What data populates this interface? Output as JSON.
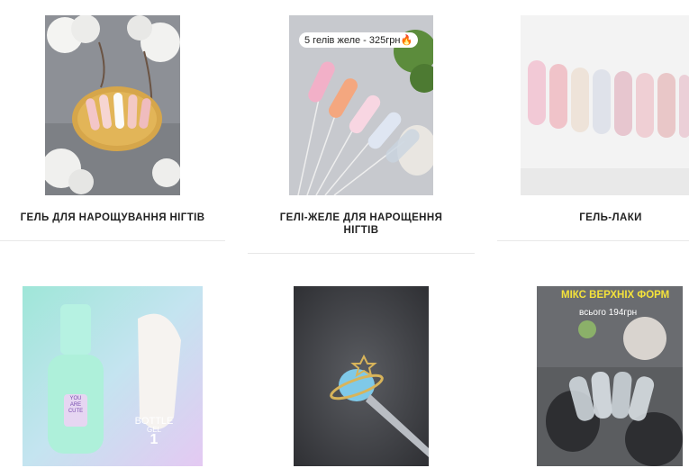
{
  "categories": [
    {
      "title": "ГЕЛЬ ДЛЯ НАРОЩУВАННЯ НІГТІВ",
      "image": "white-nail-gel-with-cotton-photo"
    },
    {
      "title": "ГЕЛІ-ЖЕЛЕ ДЛЯ НАРОЩЕННЯ НІГТІВ",
      "image": "jelly-gel-nail-tips-photo",
      "badge": "5 гелів желе - 325грн🔥"
    },
    {
      "title": "ГЕЛЬ-ЛАКИ",
      "image": "gel-polish-swatches-photo"
    },
    {
      "title": "",
      "image": "bottle-gel-photo",
      "brand_text": "YOU ARE CUTE",
      "bottle_label": "BOTTLE",
      "bottle_sub": "GEL",
      "bottle_num": "1"
    },
    {
      "title": "",
      "image": "planet-nail-charm-photo"
    },
    {
      "title": "",
      "image": "nail-forms-photo",
      "overlay_title": "МІКС ВЕРХНІХ ФОРМ",
      "overlay_sub": "всього 194грн"
    }
  ],
  "colors": {
    "title_text": "#222222",
    "divider": "#e8e8e8",
    "overlay_yellow": "#f4e23a"
  }
}
